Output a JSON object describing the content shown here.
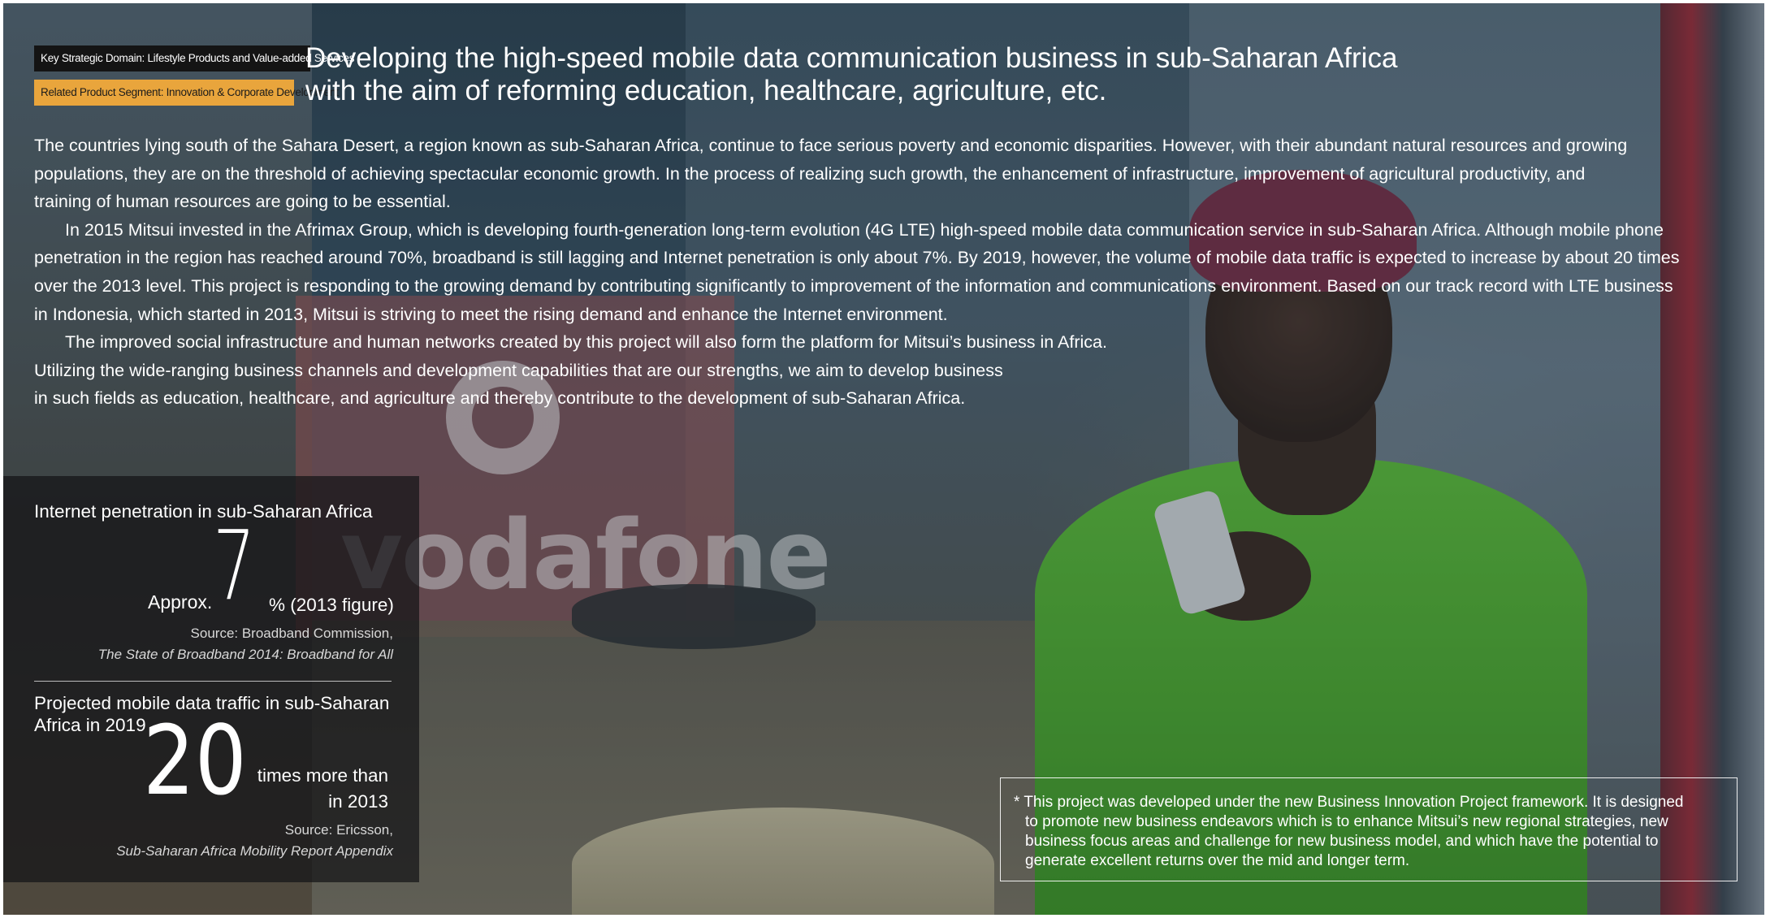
{
  "tags": {
    "domain": "Key Strategic Domain: Lifestyle Products and Value-added Services",
    "segment": "Related Product Segment: Innovation & Corporate Development"
  },
  "headline": {
    "line1": "Developing the high-speed mobile data communication business in sub-Saharan Africa",
    "line2": "with the aim of reforming education, healthcare, agriculture, etc."
  },
  "body": {
    "lines": [
      "The countries lying south of the Sahara Desert, a region known as sub-Saharan Africa, continue to face serious poverty and economic disparities. However, with their abundant natural resources and growing",
      "populations, they are on the threshold of achieving spectacular economic growth. In the process of realizing such growth, the enhancement of infrastructure, improvement of agricultural productivity, and",
      "training of human resources are going to be essential.",
      "In 2015 Mitsui invested in the Afrimax Group, which is developing fourth-generation long-term evolution (4G LTE) high-speed mobile data communication service in sub-Saharan Africa. Although mobile phone",
      "penetration in the region has reached around 70%, broadband is still lagging and Internet penetration is only about 7%. By 2019, however, the volume of mobile data traffic is expected to increase by about 20 times",
      "over the 2013 level. This project is responding to the growing demand by contributing significantly to improvement of the information and communications environment. Based on our track record with LTE business",
      "in Indonesia, which started in 2013, Mitsui is striving to meet the rising demand and enhance the Internet environment.",
      "The improved social infrastructure and human networks created by this project will also form the platform for Mitsui’s business in Africa.",
      "Utilizing the wide-ranging business channels and development capabilities that are our strengths, we aim to develop business",
      "in such fields as education, healthcare, and agriculture and thereby contribute to the development of sub-Saharan Africa."
    ]
  },
  "stats": {
    "internet": {
      "label": "Internet penetration in sub-Saharan Africa",
      "prefix": "Approx.",
      "value": "7",
      "unit": "% (2013 figure)",
      "source_line1": "Source: Broadband Commission,",
      "source_line2": "The State of Broadband 2014: Broadband for All"
    },
    "traffic": {
      "label": "Projected mobile data traffic in sub-Saharan Africa in 2019",
      "value": "20",
      "unit_line1": "times more than",
      "unit_line2": "in 2013",
      "source_line1": "Source: Ericsson,",
      "source_line2": "Sub-Saharan Africa Mobility Report Appendix"
    }
  },
  "background_sign": {
    "text": "vodafone"
  },
  "note": {
    "lines": [
      "* This project was developed under the new  Business Innovation Project framework. It is designed",
      "to promote new business endeavors which is to enhance Mitsui’s new regional strategies, new",
      "business focus areas and challenge for new business model, and which have the potential to",
      "generate excellent returns over the mid and longer term."
    ]
  }
}
